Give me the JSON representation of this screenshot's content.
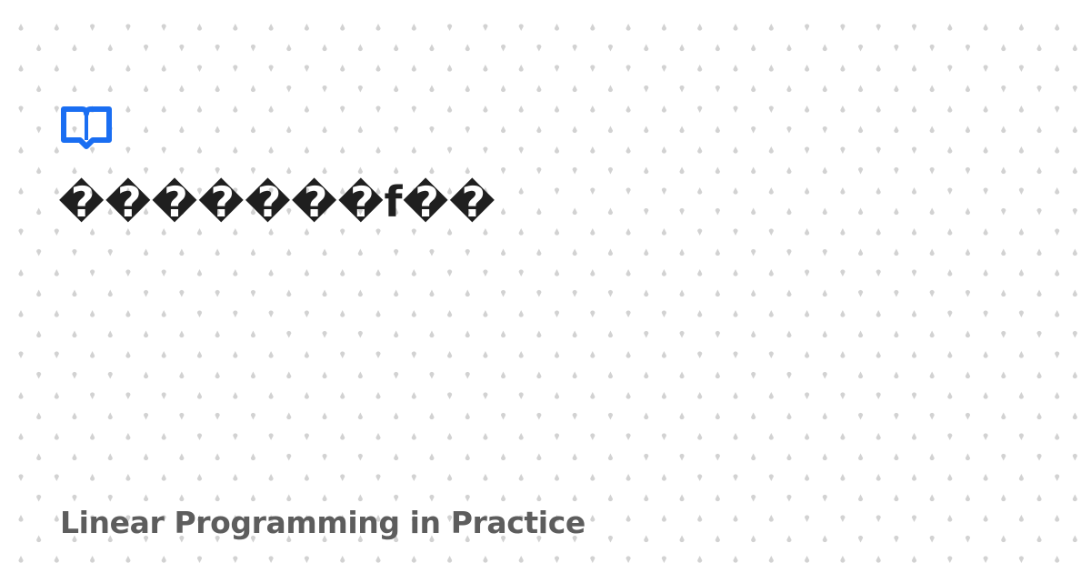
{
  "card": {
    "title": "�������f��",
    "subtitle": "Linear Programming in Practice"
  },
  "icons": {
    "logo": "open-book-icon"
  },
  "colors": {
    "background": "#ffffff",
    "pattern_dot": "#d2d2d2",
    "logo": "#1a6ef2",
    "title": "#1f1f1f",
    "subtitle": "#5d5d5d"
  }
}
